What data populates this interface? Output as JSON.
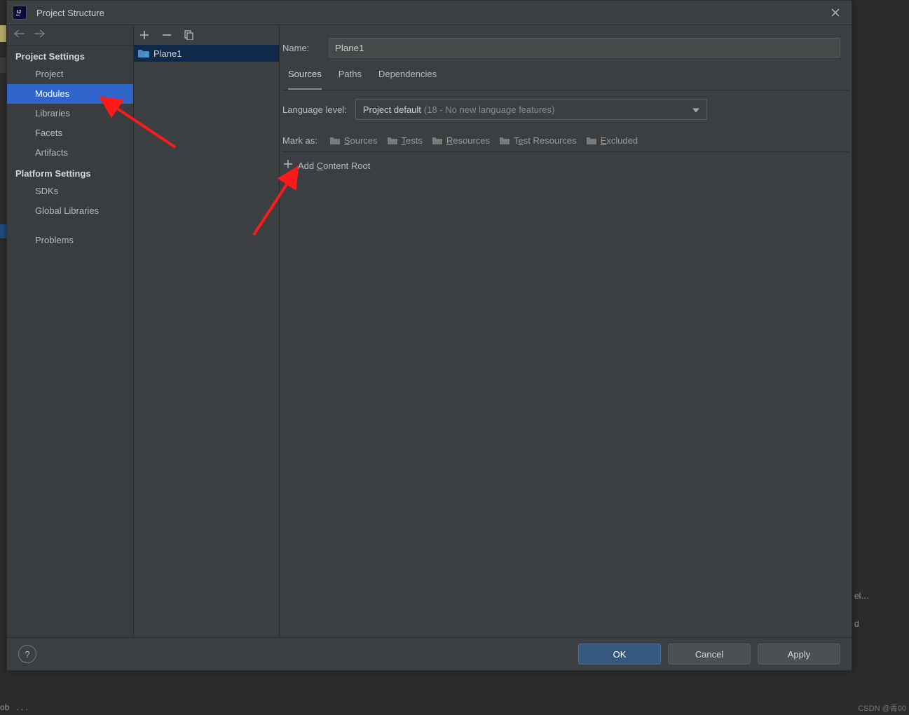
{
  "window": {
    "title": "Project Structure",
    "app_icon_letters": "IJ"
  },
  "sidebar": {
    "section1": "Project Settings",
    "items1": [
      {
        "label": "Project"
      },
      {
        "label": "Modules",
        "selected": true
      },
      {
        "label": "Libraries"
      },
      {
        "label": "Facets"
      },
      {
        "label": "Artifacts"
      }
    ],
    "section2": "Platform Settings",
    "items2": [
      {
        "label": "SDKs"
      },
      {
        "label": "Global Libraries"
      }
    ],
    "section3_item": "Problems"
  },
  "modules": {
    "items": [
      {
        "label": "Plane1",
        "selected": true
      }
    ]
  },
  "details": {
    "name_label": "Name:",
    "name_value": "Plane1",
    "tabs": [
      {
        "label": "Sources",
        "active": true
      },
      {
        "label": "Paths"
      },
      {
        "label": "Dependencies"
      }
    ],
    "language_label": "Language level:",
    "language_value": "Project default",
    "language_hint": "(18 - No new language features)",
    "mark_as_label": "Mark as:",
    "mark_options": [
      {
        "label": "Sources"
      },
      {
        "label": "Tests"
      },
      {
        "label": "Resources"
      },
      {
        "label": "Test Resources"
      },
      {
        "label": "Excluded"
      }
    ],
    "add_content_root": "Add Content Root"
  },
  "buttons": {
    "ok": "OK",
    "cancel": "Cancel",
    "apply": "Apply"
  },
  "watermark": "CSDN @青00"
}
